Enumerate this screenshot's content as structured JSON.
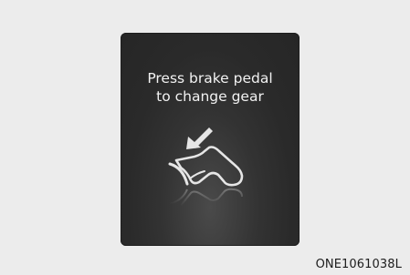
{
  "display": {
    "message_line1": "Press brake pedal",
    "message_line2": "to change gear",
    "icon": "foot-on-brake-pedal-icon"
  },
  "image_code": "ONE1061038L"
}
